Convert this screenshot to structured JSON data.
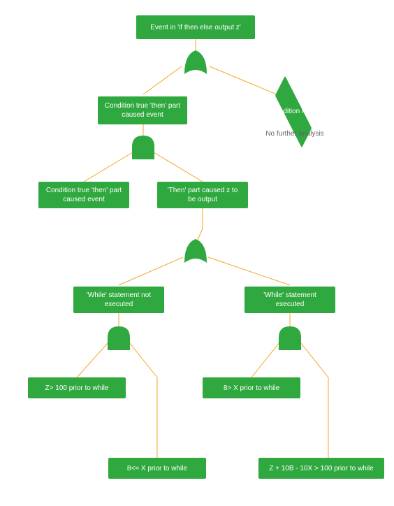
{
  "nodes": {
    "root": "Event in 'if then else output z'",
    "cond_true": "Condition true 'then' part caused event",
    "cond_false": "Condition false",
    "no_further": "No further analysis",
    "cond_true2": "Condition true 'then' part caused event",
    "then_output": "'Then' part caused z to be output",
    "while_not": "'While' statement not executed",
    "while_exec": "'While' statement executed",
    "z_gt_100": "Z> 100 prior to while",
    "eight_gt_x": "8> X prior to while",
    "eight_le_x": "8<= X prior to while",
    "z_expr": "Z + 10B - 10X > 100 prior to while"
  },
  "colors": {
    "green": "#2fa83f",
    "line": "#f5a623"
  }
}
